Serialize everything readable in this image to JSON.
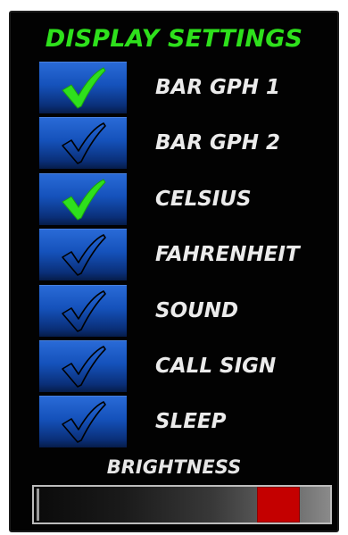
{
  "title": "DISPLAY SETTINGS",
  "colors": {
    "title": "#2ee01c",
    "check_on": "#2ee01c",
    "check_off": "#000000",
    "checkbox_blue": "#1552bb",
    "slider_thumb": "#c40000"
  },
  "options": [
    {
      "label": "BAR GPH 1",
      "checked": true,
      "icon": "check-icon"
    },
    {
      "label": "BAR GPH 2",
      "checked": false,
      "icon": "check-outline-icon"
    },
    {
      "label": "CELSIUS",
      "checked": true,
      "icon": "check-icon"
    },
    {
      "label": "FAHRENHEIT",
      "checked": false,
      "icon": "check-outline-icon"
    },
    {
      "label": "SOUND",
      "checked": false,
      "icon": "check-outline-icon"
    },
    {
      "label": "CALL SIGN",
      "checked": false,
      "icon": "check-outline-icon"
    },
    {
      "label": "SLEEP",
      "checked": false,
      "icon": "check-outline-icon"
    }
  ],
  "brightness": {
    "label": "BRIGHTNESS",
    "value": 0.88
  }
}
